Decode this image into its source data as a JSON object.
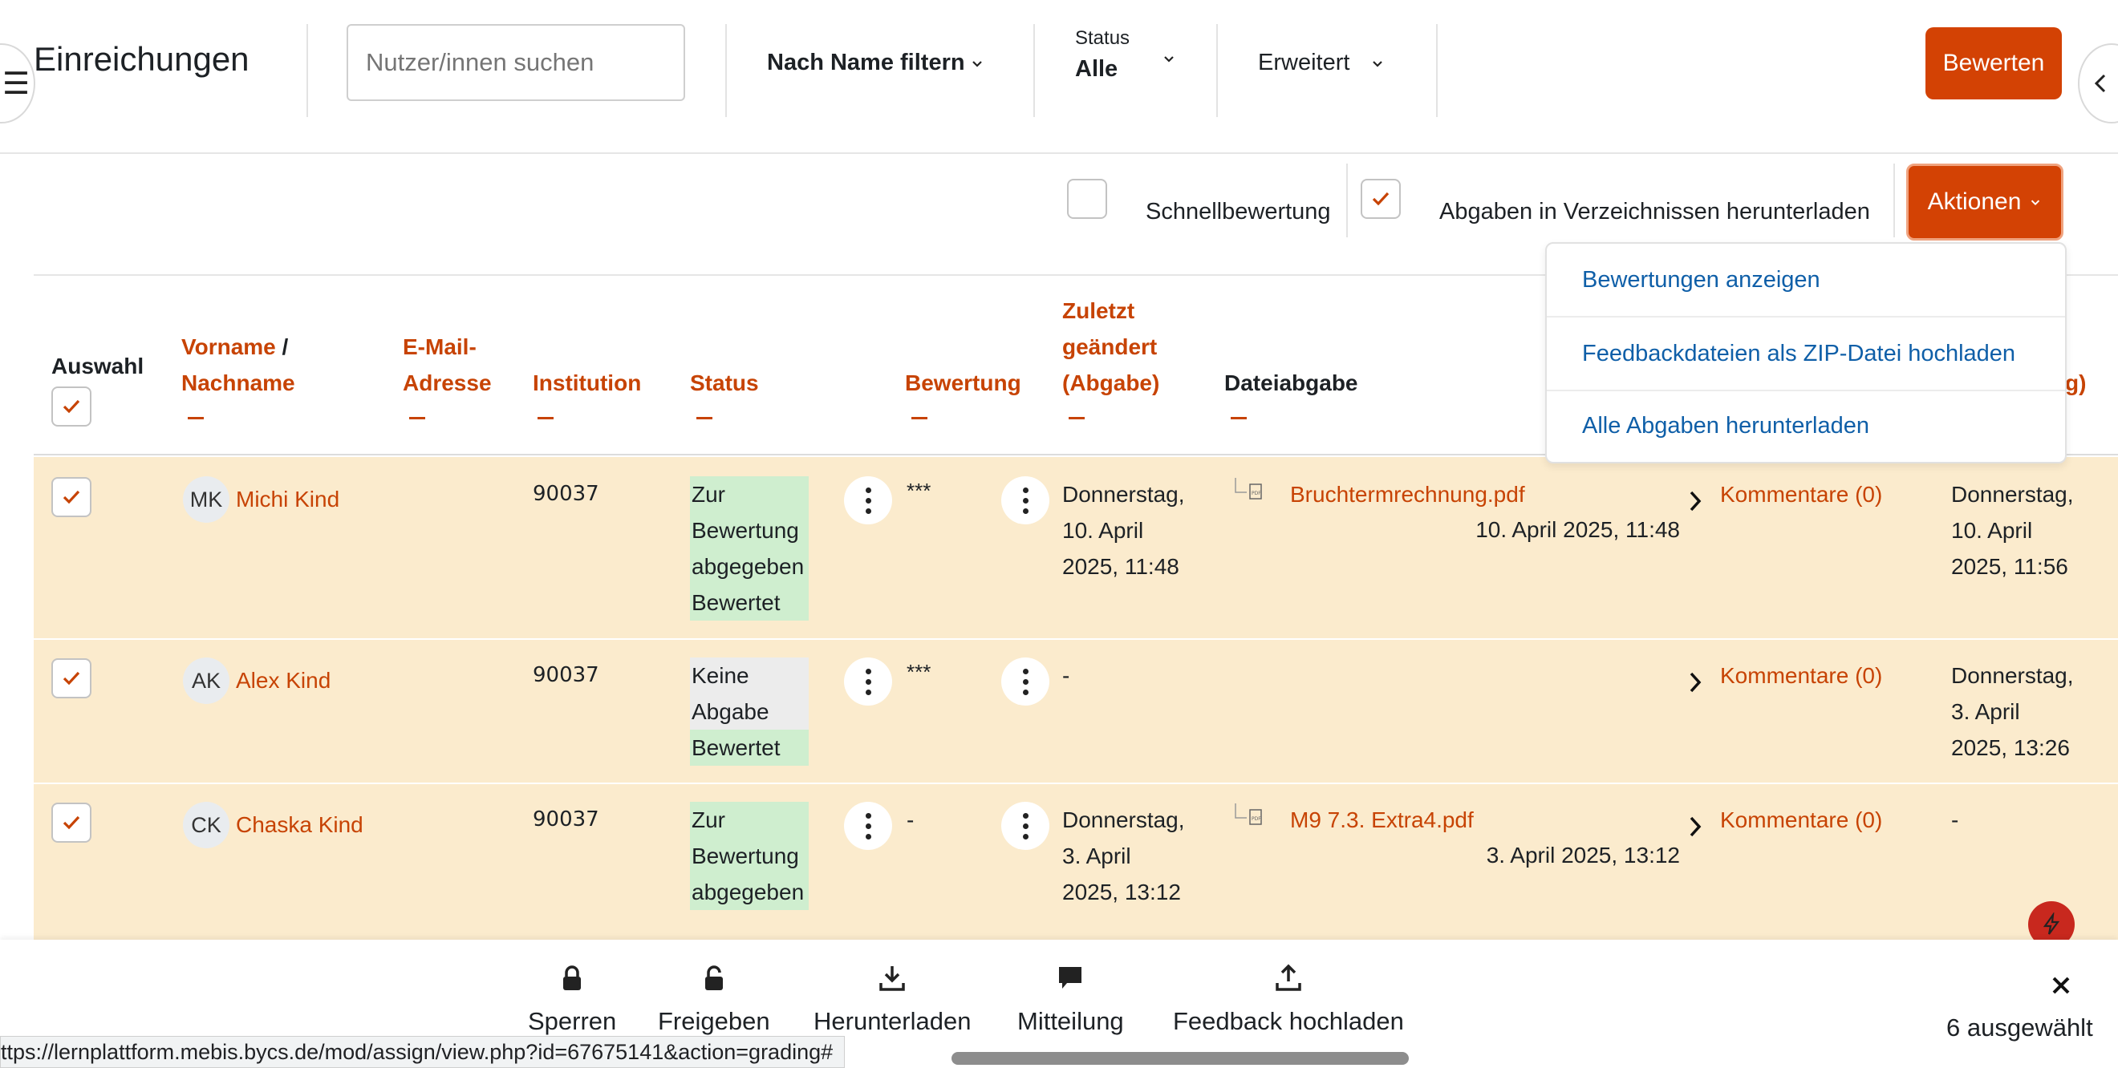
{
  "header": {
    "title": "Einreichungen",
    "search_placeholder": "Nutzer/innen suchen",
    "name_filter_label": "Nach Name filtern",
    "status_label": "Status",
    "status_value": "Alle",
    "advanced_label": "Erweitert",
    "grade_button": "Bewerten"
  },
  "toolbar": {
    "quick_grading_label": "Schnellbewertung",
    "quick_grading_checked": false,
    "download_dirs_label": "Abgaben in Verzeichnissen herunterladen",
    "download_dirs_checked": true,
    "actions_button": "Aktionen"
  },
  "actions_menu": {
    "items": [
      "Bewertungen anzeigen",
      "Feedbackdateien als ZIP-Datei hochladen",
      "Alle Abgaben herunterladen"
    ]
  },
  "table": {
    "headers": {
      "select": "Auswahl",
      "firstname": "Vorname",
      "slash": " /",
      "lastname": "Nachname",
      "email_line1": "E-Mail-",
      "email_line2": "Adresse",
      "institution": "Institution",
      "status": "Status",
      "grade": "Bewertung",
      "modified_line1": "Zuletzt",
      "modified_line2": "geändert",
      "modified_line3": "(Abgabe)",
      "file_submission": "Dateiabgabe",
      "partial_header": "g)"
    },
    "rows": [
      {
        "initials": "MK",
        "name": "Michi Kind",
        "institution": "90037",
        "status_lines": [
          "Zur",
          "Bewertung",
          "abgegeben",
          "Bewertet"
        ],
        "grade": "***",
        "modified": [
          "Donnerstag,",
          "10. April",
          "2025, 11:48"
        ],
        "file_name": "Bruchtermrechnung.pdf",
        "file_date": "10. April 2025, 11:48",
        "comments": "Kommentare (0)",
        "feedback_modified": [
          "Donnerstag,",
          "10. April",
          "2025, 11:56"
        ]
      },
      {
        "initials": "AK",
        "name": "Alex Kind",
        "institution": "90037",
        "status_lines": [
          "Keine",
          "Abgabe",
          "Bewertet"
        ],
        "grade": "***",
        "modified": [
          "-"
        ],
        "file_name": "",
        "file_date": "",
        "comments": "Kommentare (0)",
        "feedback_modified": [
          "Donnerstag,",
          "3. April",
          "2025, 13:26"
        ]
      },
      {
        "initials": "CK",
        "name": "Chaska Kind",
        "institution": "90037",
        "status_lines": [
          "Zur",
          "Bewertung",
          "abgegeben"
        ],
        "grade": "-",
        "modified": [
          "Donnerstag,",
          "3. April",
          "2025, 13:12"
        ],
        "file_name": "M9 7.3. Extra4.pdf",
        "file_date": "3. April 2025, 13:12",
        "comments": "Kommentare (0)",
        "feedback_modified": [
          "-"
        ]
      }
    ]
  },
  "bulk_actions": {
    "lock": "Sperren",
    "unlock": "Freigeben",
    "download": "Herunterladen",
    "message": "Mitteilung",
    "upload_feedback": "Feedback hochladen",
    "selected_count": "6 ausgewählt"
  },
  "statusbar": {
    "url": "ttps://lernplattform.mebis.bycs.de/mod/assign/view.php?id=67675141&action=grading#"
  },
  "colors": {
    "accent": "#d34204",
    "link": "#c74304",
    "row_bg": "#fbebcd",
    "status_green": "#cfeecf",
    "menu_link": "#0f5fa8"
  }
}
